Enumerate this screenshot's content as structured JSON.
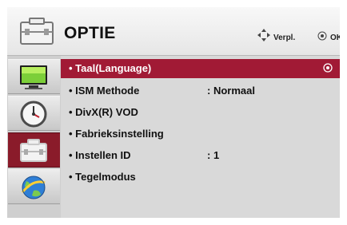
{
  "header": {
    "title": "OPTIE",
    "hint_move_label": "Verpl.",
    "hint_ok_label": "OK",
    "icon": "option-toolbox-icon"
  },
  "sidebar": {
    "items": [
      {
        "name": "picture-monitor-icon",
        "selected": false
      },
      {
        "name": "clock-icon",
        "selected": false
      },
      {
        "name": "option-toolbox-icon",
        "selected": true
      },
      {
        "name": "network-globe-icon",
        "selected": false
      }
    ]
  },
  "menu": {
    "items": [
      {
        "label": "• Taal(Language)",
        "value": "",
        "selected": true
      },
      {
        "label": "• ISM Methode",
        "value": ": Normaal",
        "selected": false
      },
      {
        "label": "• DivX(R) VOD",
        "value": "",
        "selected": false
      },
      {
        "label": "• Fabrieksinstelling",
        "value": "",
        "selected": false
      },
      {
        "label": "• Instellen ID",
        "value": ": 1",
        "selected": false
      },
      {
        "label": "• Tegelmodus",
        "value": "",
        "selected": false
      }
    ]
  },
  "colors": {
    "selected_row": "#a11a35",
    "selected_sidebar": "#8a1b2a",
    "panel_bg": "#d9d9d9"
  }
}
